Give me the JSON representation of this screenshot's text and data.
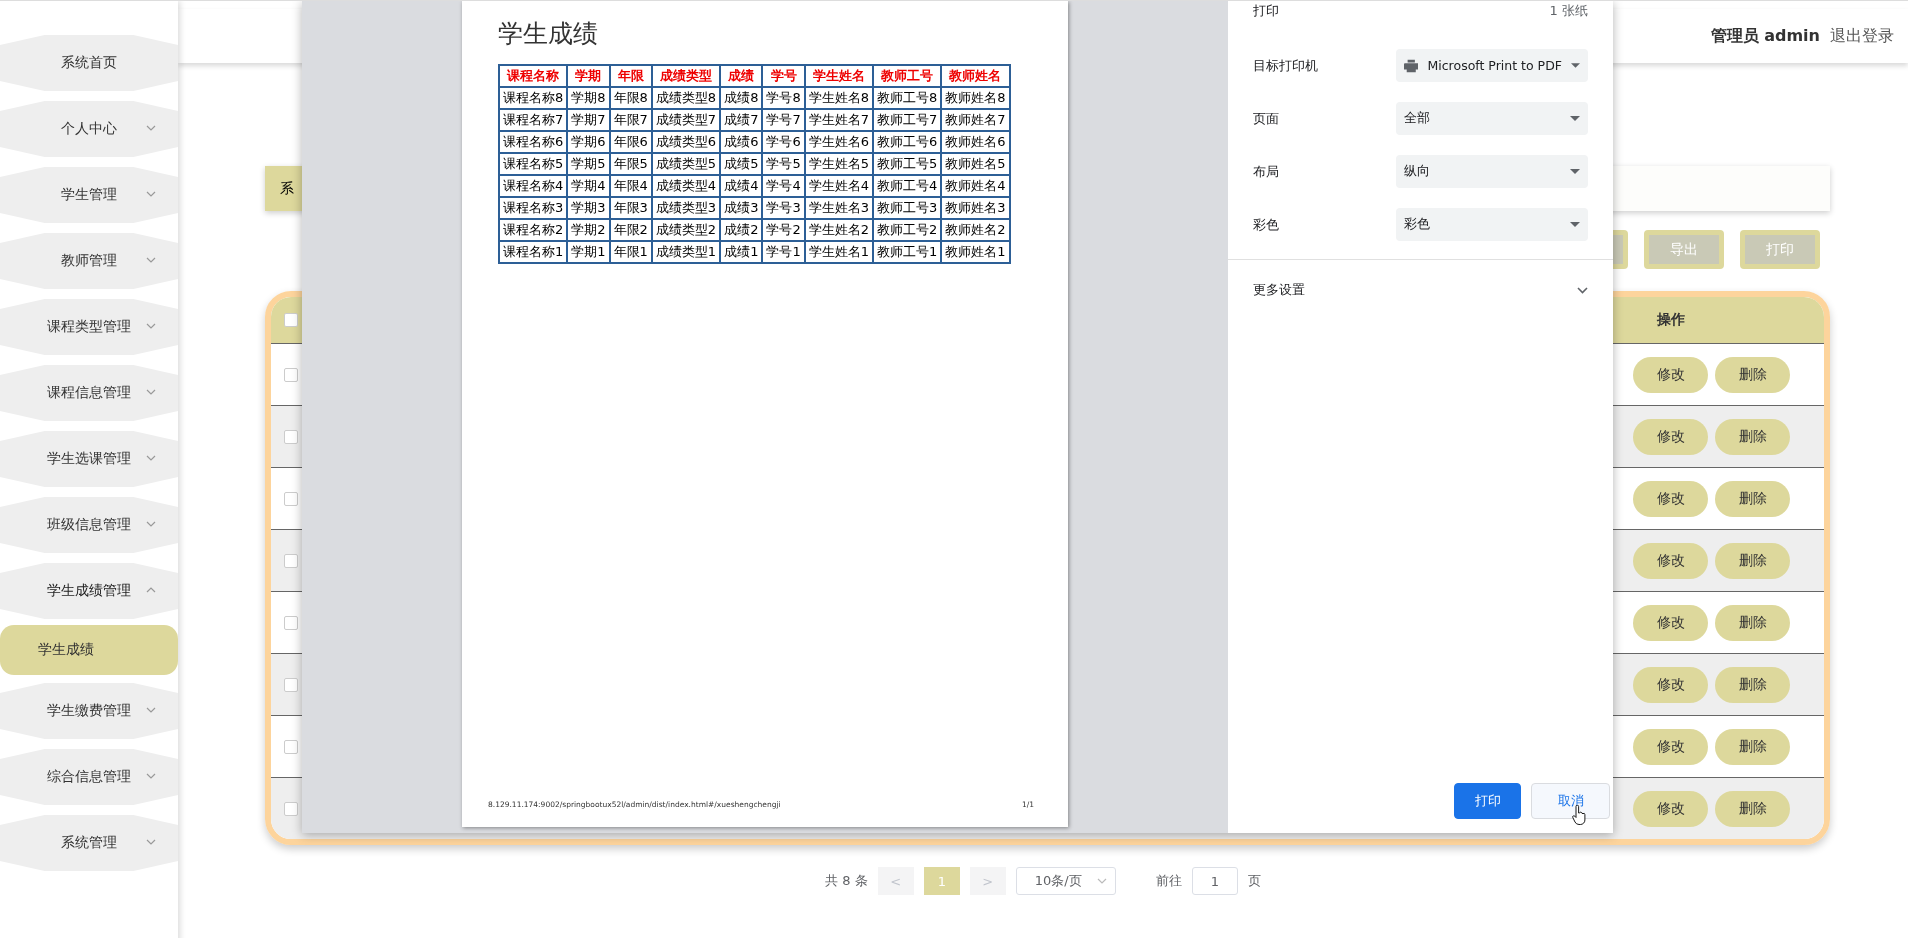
{
  "sidebar": {
    "items": [
      {
        "label": "系统首页",
        "kind": "link"
      },
      {
        "label": "个人中心",
        "kind": "menu",
        "expanded": false
      },
      {
        "label": "学生管理",
        "kind": "menu",
        "expanded": false
      },
      {
        "label": "教师管理",
        "kind": "menu",
        "expanded": false
      },
      {
        "label": "课程类型管理",
        "kind": "menu",
        "expanded": false
      },
      {
        "label": "课程信息管理",
        "kind": "menu",
        "expanded": false
      },
      {
        "label": "学生选课管理",
        "kind": "menu",
        "expanded": false
      },
      {
        "label": "班级信息管理",
        "kind": "menu",
        "expanded": false
      },
      {
        "label": "学生成绩管理",
        "kind": "menu",
        "expanded": true,
        "children": [
          {
            "label": "学生成绩",
            "selected": true
          }
        ]
      },
      {
        "label": "学生缴费管理",
        "kind": "menu",
        "expanded": false
      },
      {
        "label": "综合信息管理",
        "kind": "menu",
        "expanded": false
      },
      {
        "label": "系统管理",
        "kind": "menu",
        "expanded": false
      }
    ]
  },
  "header": {
    "user": "管理员 admin",
    "logout": "退出登录"
  },
  "breadcrumb": {
    "text": "系"
  },
  "toolbar": {
    "buttons": [
      "导出",
      "打印"
    ]
  },
  "table": {
    "all_checked": false,
    "columns": [
      {
        "label": "操作"
      }
    ],
    "rows": [
      {
        "checked": false,
        "actions": [
          "修改",
          "删除"
        ]
      },
      {
        "checked": false,
        "actions": [
          "修改",
          "删除"
        ]
      },
      {
        "checked": false,
        "actions": [
          "修改",
          "删除"
        ]
      },
      {
        "checked": false,
        "actions": [
          "修改",
          "删除"
        ]
      },
      {
        "checked": false,
        "actions": [
          "修改",
          "删除"
        ]
      },
      {
        "checked": false,
        "actions": [
          "修改",
          "删除"
        ]
      },
      {
        "checked": false,
        "actions": [
          "修改",
          "删除"
        ]
      },
      {
        "checked": false,
        "actions": [
          "修改",
          "删除"
        ]
      }
    ]
  },
  "pagination": {
    "total": "共 8 条",
    "prev": "<",
    "pages": [
      {
        "label": "1",
        "selected": true
      }
    ],
    "next": ">",
    "page_size": "10条/页",
    "goto_label": "前往",
    "goto_value": "1",
    "goto_suffix": "页"
  },
  "print_dialog": {
    "preview": {
      "title": "学生成绩",
      "columns": [
        "课程名称",
        "学期",
        "年限",
        "成绩类型",
        "成绩",
        "学号",
        "学生姓名",
        "教师工号",
        "教师姓名"
      ],
      "rows": [
        [
          "课程名称8",
          "学期8",
          "年限8",
          "成绩类型8",
          "成绩8",
          "学号8",
          "学生姓名8",
          "教师工号8",
          "教师姓名8"
        ],
        [
          "课程名称7",
          "学期7",
          "年限7",
          "成绩类型7",
          "成绩7",
          "学号7",
          "学生姓名7",
          "教师工号7",
          "教师姓名7"
        ],
        [
          "课程名称6",
          "学期6",
          "年限6",
          "成绩类型6",
          "成绩6",
          "学号6",
          "学生姓名6",
          "教师工号6",
          "教师姓名6"
        ],
        [
          "课程名称5",
          "学期5",
          "年限5",
          "成绩类型5",
          "成绩5",
          "学号5",
          "学生姓名5",
          "教师工号5",
          "教师姓名5"
        ],
        [
          "课程名称4",
          "学期4",
          "年限4",
          "成绩类型4",
          "成绩4",
          "学号4",
          "学生姓名4",
          "教师工号4",
          "教师姓名4"
        ],
        [
          "课程名称3",
          "学期3",
          "年限3",
          "成绩类型3",
          "成绩3",
          "学号3",
          "学生姓名3",
          "教师工号3",
          "教师姓名3"
        ],
        [
          "课程名称2",
          "学期2",
          "年限2",
          "成绩类型2",
          "成绩2",
          "学号2",
          "学生姓名2",
          "教师工号2",
          "教师姓名2"
        ],
        [
          "课程名称1",
          "学期1",
          "年限1",
          "成绩类型1",
          "成绩1",
          "学号1",
          "学生姓名1",
          "教师工号1",
          "教师姓名1"
        ]
      ],
      "footer_url": "8.129.11.174:9002/springbootux52l/admin/dist/index.html#/xueshengchengji",
      "page_number": "1/1"
    },
    "settings": {
      "title": "打印",
      "sheets": "1 张纸",
      "fields": [
        {
          "label": "目标打印机",
          "value": "Microsoft Print to PDF",
          "kind": "printer"
        },
        {
          "label": "页面",
          "value": "全部",
          "kind": "select"
        },
        {
          "label": "布局",
          "value": "纵向",
          "kind": "select"
        },
        {
          "label": "彩色",
          "value": "彩色",
          "kind": "select"
        }
      ],
      "more": "更多设置",
      "buttons": [
        {
          "label": "打印",
          "kind": "primary"
        },
        {
          "label": "取消",
          "kind": "secondary"
        }
      ]
    }
  }
}
